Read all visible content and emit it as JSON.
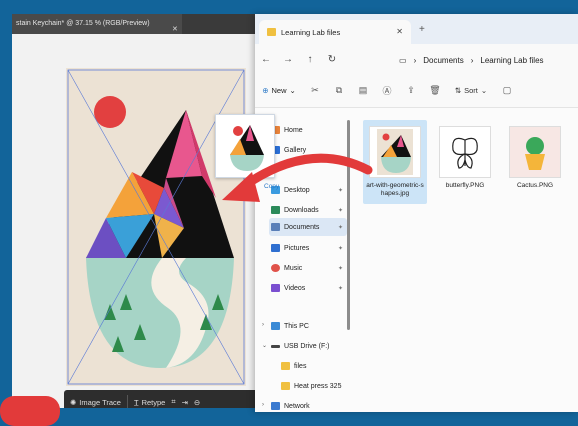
{
  "illustrator": {
    "tab_title": "stain Keychain* @ 37.15 % (RGB/Preview)",
    "tab_close": "✕",
    "toolbar": {
      "image_trace": "Image Trace",
      "retype": "Retype"
    }
  },
  "explorer": {
    "tab_title": "Learning Lab files",
    "tab_close": "✕",
    "new_tab": "+",
    "nav": {
      "back": "←",
      "forward": "→",
      "up": "↑",
      "refresh": "↻"
    },
    "breadcrumb": [
      "Documents",
      "Learning Lab files"
    ],
    "breadcrumb_sep": "›",
    "breadcrumb_lead": "›",
    "cmd": {
      "new_label": "New",
      "sort_label": "Sort"
    },
    "sidebar": [
      {
        "label": "Home",
        "color": "#e8833a"
      },
      {
        "label": "Gallery",
        "color": "#2a6fd6"
      },
      {
        "label": "Desktop",
        "color": "#3a9be0",
        "pin": "📌"
      },
      {
        "label": "Downloads",
        "color": "#2b8a5a",
        "pin": "📌"
      },
      {
        "label": "Documents",
        "color": "#5a7fb8",
        "pin": "📌"
      },
      {
        "label": "Pictures",
        "color": "#2f6fd0",
        "pin": "📌"
      },
      {
        "label": "Music",
        "color": "#e0524a",
        "pin": "📌"
      },
      {
        "label": "Videos",
        "color": "#7a4fd0",
        "pin": "📌"
      },
      {
        "label": "This PC",
        "color": "#3a8ad6"
      },
      {
        "label": "USB Drive (F:)",
        "color": "#444444"
      },
      {
        "label": "files",
        "color": "#f0c040"
      },
      {
        "label": "Heat press 325",
        "color": "#f0c040"
      },
      {
        "label": "Network",
        "color": "#3a7ad0"
      }
    ],
    "files": [
      {
        "name": "art-with-geometric-shapes.jpg"
      },
      {
        "name": "butterfly.PNG"
      },
      {
        "name": "Cactus.PNG"
      }
    ],
    "copy_label": "Copy"
  },
  "colors": {
    "background": "#12649a",
    "accent_red": "#e23a3a",
    "selection": "#cce4f7"
  }
}
